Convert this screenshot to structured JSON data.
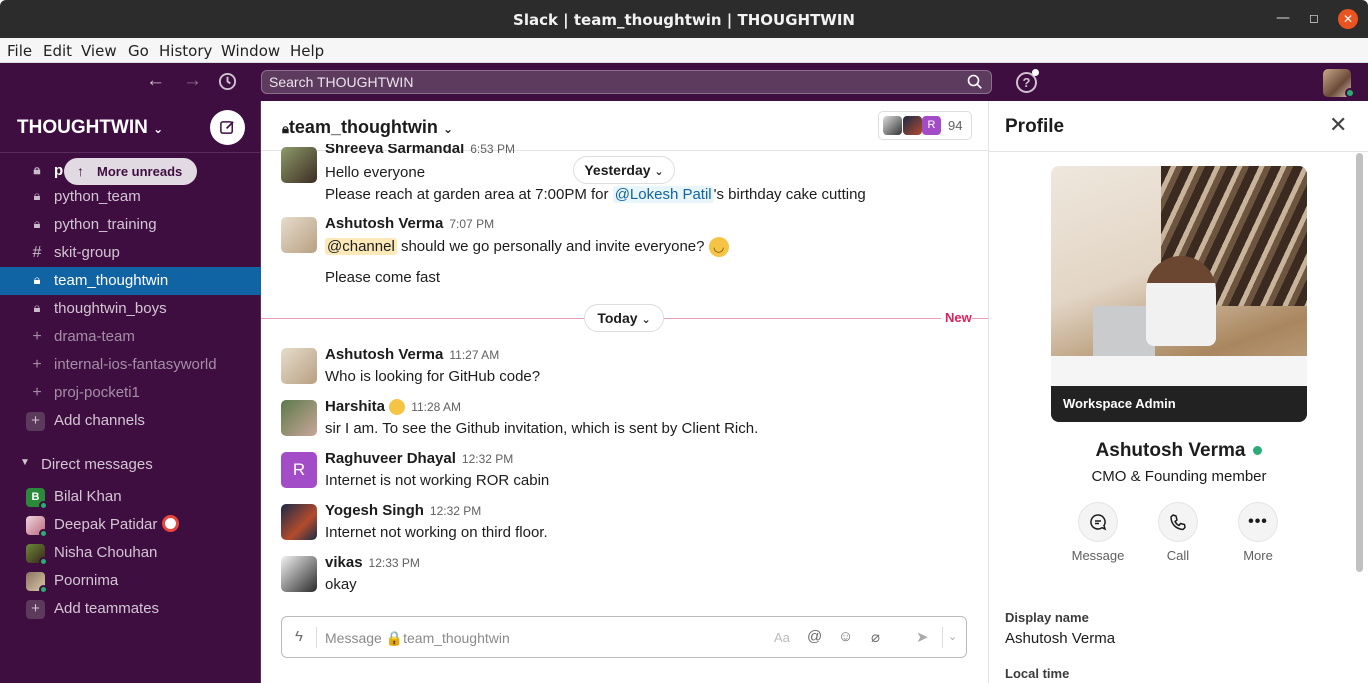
{
  "window": {
    "title": "Slack | team_thoughtwin | THOUGHTWIN",
    "close_glyph": "✕"
  },
  "menu": [
    "File",
    "Edit",
    "View",
    "Go",
    "History",
    "Window",
    "Help"
  ],
  "topbar": {
    "search_placeholder": "Search THOUGHTWIN",
    "help_glyph": "?"
  },
  "sidebar": {
    "workspace": "THOUGHTWIN",
    "more_unreads": "More unreads",
    "partial_channel": "p",
    "channels": [
      {
        "label": "python_team",
        "icon": "lock"
      },
      {
        "label": "python_training",
        "icon": "lock"
      },
      {
        "label": "skit-group",
        "icon": "hash"
      },
      {
        "label": "team_thoughtwin",
        "icon": "lock",
        "active": true
      },
      {
        "label": "thoughtwin_boys",
        "icon": "lock"
      },
      {
        "label": "drama-team",
        "icon": "plus"
      },
      {
        "label": "internal-ios-fantasyworld",
        "icon": "plus"
      },
      {
        "label": "proj-pocketi1",
        "icon": "plus"
      }
    ],
    "add_channels": "Add channels",
    "dm_header": "Direct messages",
    "dms": [
      {
        "name": "Bilal Khan",
        "avatar_letter": "B"
      },
      {
        "name": "Deepak Patidar"
      },
      {
        "name": "Nisha Chouhan"
      },
      {
        "name": "Poornima"
      }
    ],
    "add_teammates": "Add teammates"
  },
  "channel": {
    "name": "team_thoughtwin",
    "member_count": "94",
    "member_letter": "R"
  },
  "day_pills": {
    "yesterday": "Yesterday",
    "today": "Today",
    "new": "New"
  },
  "messages": {
    "m1": {
      "author": "Shreeya Sarmandal",
      "time": "6:53 PM",
      "text1": "Hello everyone",
      "text2a": "Please reach at garden area at 7:00PM for ",
      "mention": "@Lokesh Patil",
      "text2b": "'s birthday cake cutting"
    },
    "m2": {
      "author": "Ashutosh Verma",
      "time": "7:07 PM",
      "channel_mention": "@channel",
      "text1": " should we go personally and invite everyone?",
      "text2": "Please come fast"
    },
    "m3": {
      "author": "Ashutosh Verma",
      "time": "11:27 AM",
      "text": "Who is looking for GitHub code?"
    },
    "m4": {
      "author": "Harshita",
      "time": "11:28 AM",
      "text": "sir I am. To see the Github invitation, which is sent by Client Rich."
    },
    "m5": {
      "author": "Raghuveer Dhayal",
      "time": "12:32 PM",
      "avatar_letter": "R",
      "text": "Internet is not working ROR cabin"
    },
    "m6": {
      "author": "Yogesh Singh",
      "time": "12:32 PM",
      "text": "Internet not working on third floor."
    },
    "m7": {
      "author": "vikas",
      "time": "12:33 PM",
      "text": "okay"
    }
  },
  "composer": {
    "placeholder": "Message 🔒team_thoughtwin",
    "format_glyph": "Aa"
  },
  "profile": {
    "title": "Profile",
    "badge": "Workspace Admin",
    "name": "Ashutosh Verma",
    "role": "CMO & Founding member",
    "actions": [
      "Message",
      "Call",
      "More"
    ],
    "display_name_label": "Display name",
    "display_name": "Ashutosh Verma",
    "local_time_label": "Local time"
  },
  "colors": {
    "aubergine": "#3f0e40",
    "active": "#1164a3",
    "online": "#2bac76",
    "new": "#e01e5a"
  }
}
